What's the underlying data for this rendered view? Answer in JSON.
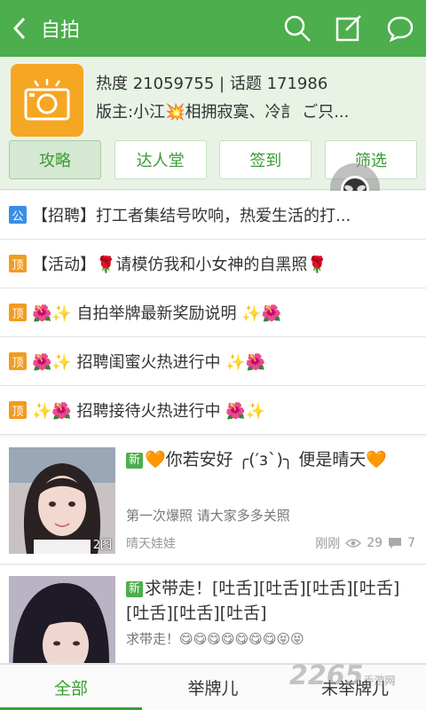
{
  "header": {
    "title": "自拍",
    "back_icon": "chevron-left-icon",
    "actions": [
      "search-icon",
      "compose-icon",
      "chat-bubble-icon"
    ]
  },
  "forum": {
    "stats": "热度 21059755 | 话题 171986",
    "moderators": "版主:小江💥相拥寂寞、冷訁 ご只...",
    "tabs": [
      "攻略",
      "达人堂",
      "签到",
      "筛选"
    ],
    "active_tab": 0
  },
  "pinned": [
    {
      "tag": "公",
      "text": "【招聘】打工者集结号吹响，热爱生活的打..."
    },
    {
      "tag": "顶",
      "text": "【活动】🌹请模仿我和小女神的自黑照🌹"
    },
    {
      "tag": "顶",
      "text": "🌺✨ 自拍举牌最新奖励说明 ✨🌺"
    },
    {
      "tag": "顶",
      "text": "🌺✨ 招聘闺蜜火热进行中 ✨🌺"
    },
    {
      "tag": "顶",
      "text": "✨🌺 招聘接待火热进行中 🌺✨"
    }
  ],
  "posts": [
    {
      "badge": "新",
      "title": "🧡你若安好 ╭(′з`)╮ 便是晴天🧡",
      "summary": "第一次爆照 请大家多多关照",
      "author": "晴天娃娃",
      "time": "刚刚",
      "views": "29",
      "comments": "7",
      "image_count": "2图"
    },
    {
      "badge": "新",
      "title": "求带走！[吐舌][吐舌][吐舌][吐舌][吐舌][吐舌][吐舌]",
      "summary": "求带走！😋😋😋😋😋😋😋😝😝",
      "author": "",
      "time": "",
      "views": "",
      "comments": "",
      "image_count": ""
    }
  ],
  "bottom_tabs": [
    "全部",
    "举牌儿",
    "未举牌儿"
  ],
  "bottom_active": 0,
  "watermark": {
    "brand": "2265",
    "sub": "手游网"
  },
  "colors": {
    "primary": "#4cae4c",
    "accent": "#3aa035",
    "tag_gong": "#3a8ee6",
    "tag_ding": "#f39b1f",
    "avatar_bg": "#f5a623"
  }
}
